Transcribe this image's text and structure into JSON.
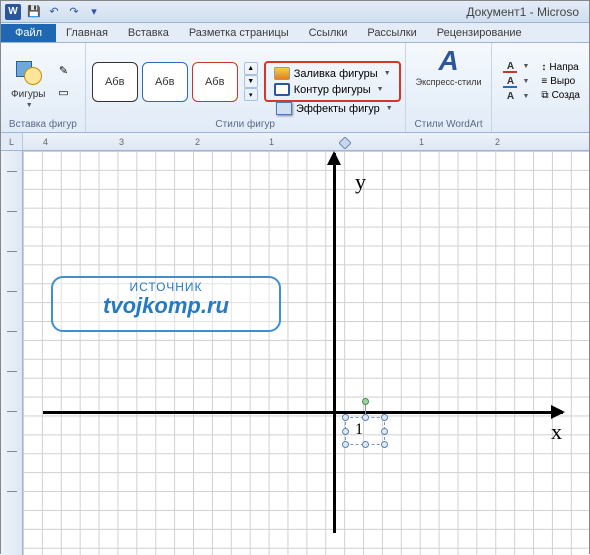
{
  "title": "Документ1 - Microso",
  "qat": {
    "save": "💾",
    "undo": "↶",
    "redo": "↷",
    "more": "▾"
  },
  "tabs": {
    "file": "Файл",
    "items": [
      "Главная",
      "Вставка",
      "Разметка страницы",
      "Ссылки",
      "Рассылки",
      "Рецензирование"
    ]
  },
  "ribbon": {
    "insertShapes": {
      "label": "Вставка фигур",
      "button": "Фигуры"
    },
    "shapeStyles": {
      "label": "Стили фигур",
      "sample": "Абв",
      "fill": "Заливка фигуры",
      "outline": "Контур фигуры",
      "effects": "Эффекты фигур"
    },
    "wordArt": {
      "label": "Стили WordArt",
      "button": "Экспресс-стили",
      "dir": "Напра",
      "align": "Выро",
      "create": "Созда"
    }
  },
  "ruler": {
    "corner": "L",
    "nums": [
      "4",
      "3",
      "2",
      "1",
      "1",
      "2"
    ]
  },
  "canvas": {
    "y": "y",
    "x": "x",
    "one": "1"
  },
  "watermark": {
    "t1": "ИСТОЧНИК",
    "t2": "tvojkomp.ru"
  }
}
